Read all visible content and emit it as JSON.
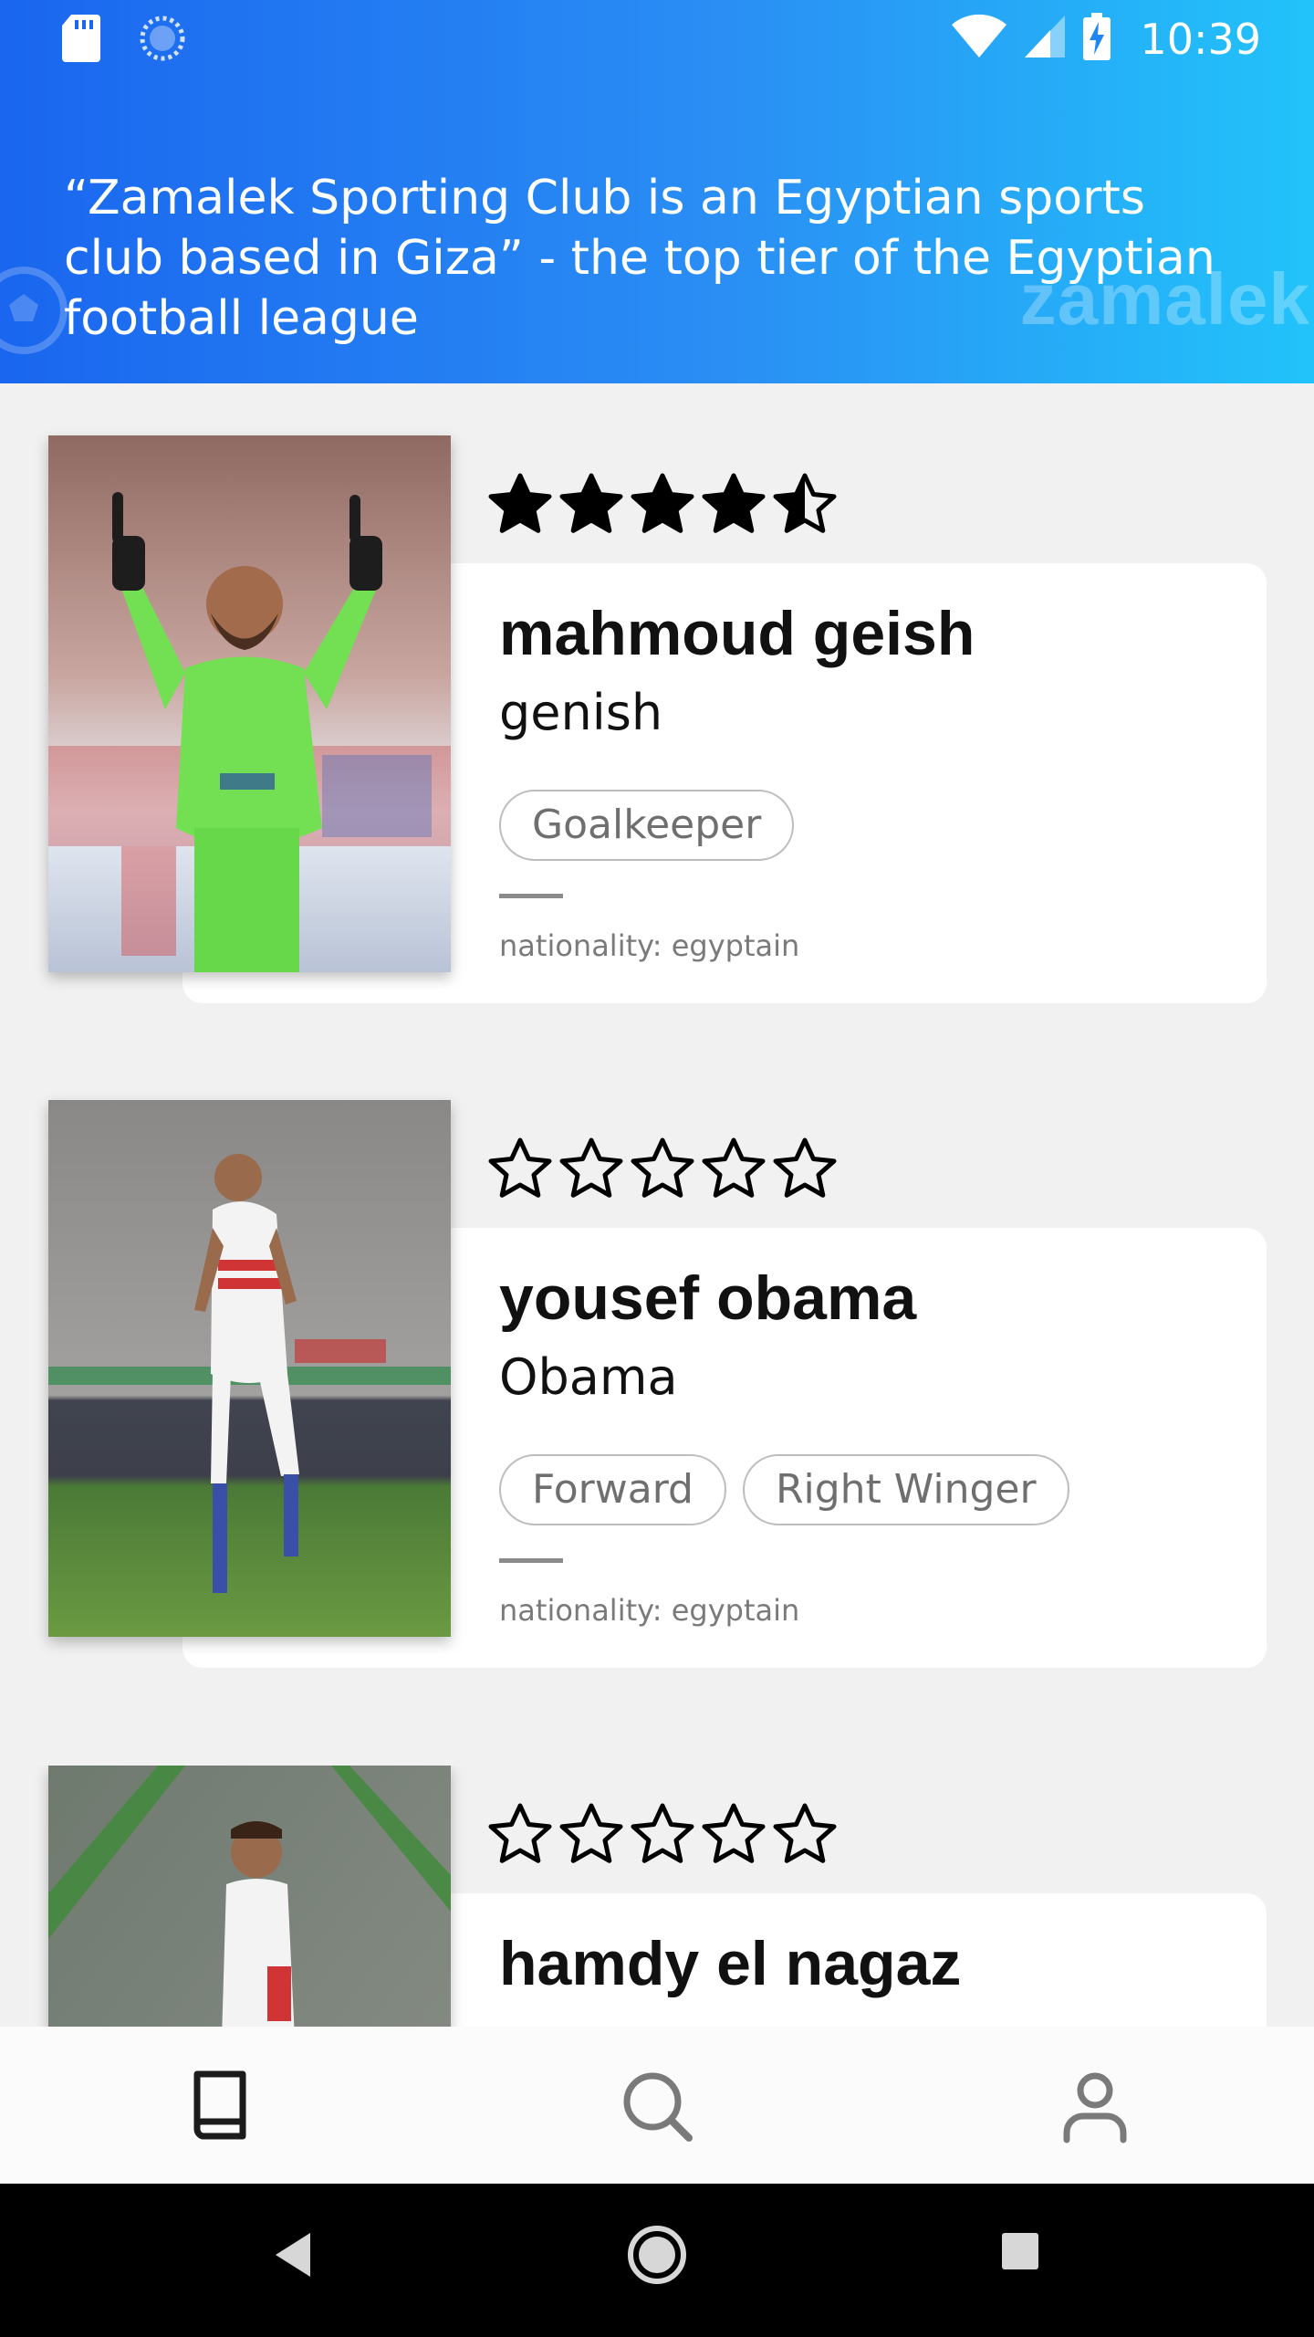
{
  "status_bar": {
    "time": "10:39"
  },
  "header": {
    "tagline": "“Zamalek Sporting Club is an Egyptian sports club based in Giza” - the top tier of the Egyptian football league",
    "watermark": "zamalek"
  },
  "colors": {
    "header_gradient_start": "#1a66ef",
    "header_gradient_end": "#22c3fa",
    "background": "#f1f1f1",
    "card": "#ffffff"
  },
  "players": [
    {
      "name": "mahmoud geish",
      "nickname": "genish",
      "positions": [
        "Goalkeeper"
      ],
      "nationality": "nationality: egyptain",
      "rating": 4.5,
      "max_rating": 5
    },
    {
      "name": "yousef obama",
      "nickname": "Obama",
      "positions": [
        "Forward",
        "Right Winger"
      ],
      "nationality": "nationality: egyptain",
      "rating": 0,
      "max_rating": 5
    },
    {
      "name": "hamdy el nagaz",
      "rating": 0,
      "max_rating": 5
    }
  ],
  "bottom_nav": {
    "items": [
      {
        "icon": "book-icon",
        "active": true
      },
      {
        "icon": "search-icon",
        "active": false
      },
      {
        "icon": "person-icon",
        "active": false
      }
    ]
  },
  "system_nav": {
    "icons": [
      "back-icon",
      "home-icon",
      "recents-icon"
    ]
  }
}
